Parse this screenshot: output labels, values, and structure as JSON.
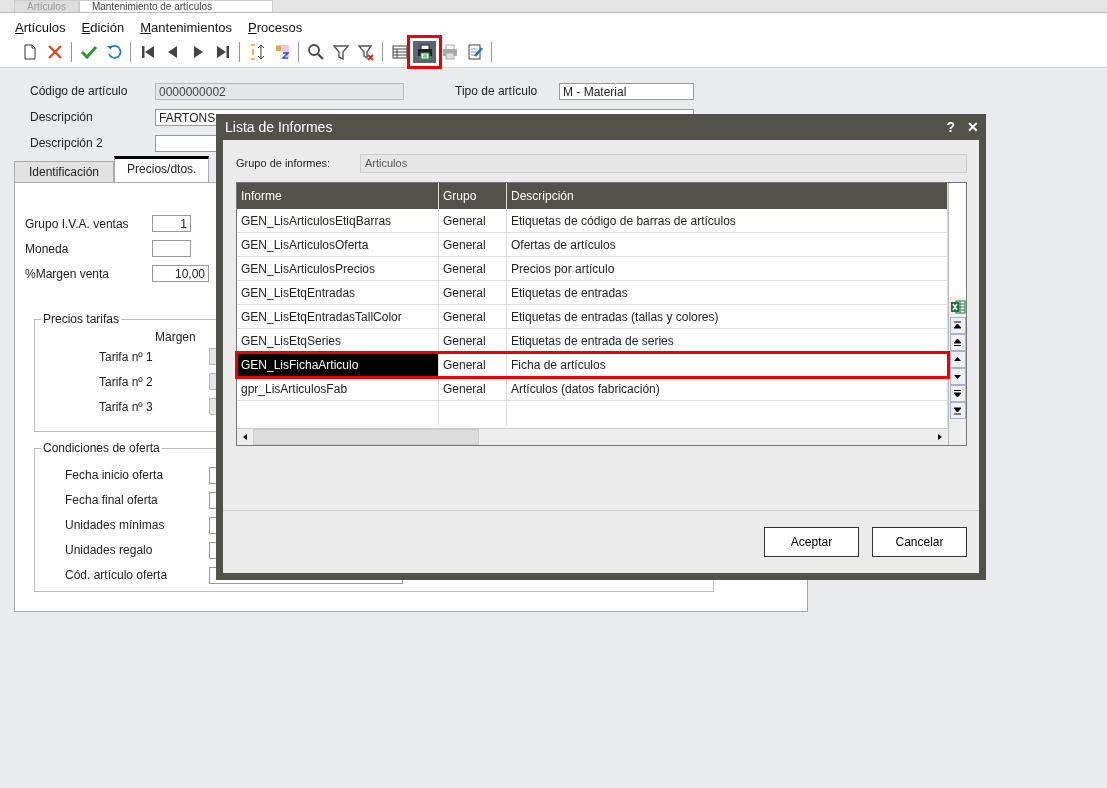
{
  "doc_tabs": [
    {
      "label": "Artículos",
      "selected": false
    },
    {
      "label": "Mantenimiento de artículos",
      "selected": true
    }
  ],
  "menu": [
    "Artículos",
    "Edición",
    "Mantenimientos",
    "Procesos"
  ],
  "toolbar": [
    [
      {
        "kind": "new",
        "highlighted": false
      },
      {
        "kind": "delete",
        "highlighted": false
      }
    ],
    [
      {
        "kind": "accept",
        "highlighted": false
      },
      {
        "kind": "undo",
        "highlighted": false
      }
    ],
    [
      {
        "kind": "first",
        "highlighted": false
      },
      {
        "kind": "prev",
        "highlighted": false
      },
      {
        "kind": "next",
        "highlighted": false
      },
      {
        "kind": "last",
        "highlighted": false
      }
    ],
    [
      {
        "kind": "sort",
        "highlighted": false
      },
      {
        "kind": "sortaz",
        "highlighted": false
      }
    ],
    [
      {
        "kind": "search",
        "highlighted": false
      },
      {
        "kind": "filter",
        "highlighted": false
      },
      {
        "kind": "clearfilter",
        "highlighted": false
      }
    ],
    [
      {
        "kind": "grid",
        "highlighted": false
      },
      {
        "kind": "print",
        "highlighted": true
      },
      {
        "kind": "printgrey",
        "highlighted": false
      },
      {
        "kind": "edit",
        "highlighted": false
      }
    ]
  ],
  "header_fields": [
    {
      "label": "Código de artículo",
      "value": "0000000002",
      "readonly": true
    },
    {
      "label": "Tipo de artículo",
      "value": "M  - Material",
      "readonly": false
    },
    {
      "label": "Descripción",
      "value": "FARTONS",
      "readonly": false
    },
    {
      "label": "Descripción 2",
      "readonly": false
    }
  ],
  "form_tabs": [
    {
      "label": "Identificación",
      "selected": false
    },
    {
      "label": "Precios/dtos.",
      "selected": true
    }
  ],
  "price_fields": [
    {
      "label": "Grupo I.V.A. ventas",
      "value": "1"
    },
    {
      "label": "Moneda"
    },
    {
      "label": "%Margen venta",
      "value": "10,00"
    }
  ],
  "precios_tarifas": {
    "title": "Precios tarifas",
    "column": "Margen",
    "rows": [
      "Tarifa nº 1",
      "Tarifa nº 2",
      "Tarifa nº 3"
    ]
  },
  "condiciones_oferta": {
    "title": "Condiciones de oferta",
    "rows": [
      "Fecha inicio oferta",
      "Fecha final oferta",
      "Unidades mínimas",
      "Unidades regalo",
      "Cód. artículo oferta"
    ]
  },
  "dialog": {
    "title": "Lista de Informes",
    "help": "?",
    "close": "✕",
    "group_label": "Grupo de informes:",
    "group_value": "Articulos",
    "columns": [
      "Informe",
      "Grupo",
      "Descripción"
    ],
    "rows": [
      {
        "informe": "GEN_LisArticulosEtiqBarras",
        "grupo": "General",
        "descripcion": "Etiquetas de código de barras de artículos",
        "selected": false
      },
      {
        "informe": "GEN_LisArticulosOferta",
        "grupo": "General",
        "descripcion": "Ofertas de artículos",
        "selected": false
      },
      {
        "informe": "GEN_LisArticulosPrecios",
        "grupo": "General",
        "descripcion": "Precios por artículo",
        "selected": false
      },
      {
        "informe": "GEN_LisEtqEntradas",
        "grupo": "General",
        "descripcion": "Etiquetas de entradas",
        "selected": false
      },
      {
        "informe": "GEN_LisEtqEntradasTallColor",
        "grupo": "General",
        "descripcion": "Etiquetas de entradas (tallas y colores)",
        "selected": false
      },
      {
        "informe": "GEN_LisEtqSeries",
        "grupo": "General",
        "descripcion": "Etiquetas de entrada de series",
        "selected": false
      },
      {
        "informe": "GEN_LisFichaArticulo",
        "grupo": "General",
        "descripcion": "Ficha de artículos",
        "selected": true
      },
      {
        "informe": "gpr_LisArticulosFab",
        "grupo": "General",
        "descripcion": "Artículos (datos fabricación)",
        "selected": false
      }
    ],
    "buttons": [
      "Aceptar",
      "Cancelar"
    ]
  }
}
